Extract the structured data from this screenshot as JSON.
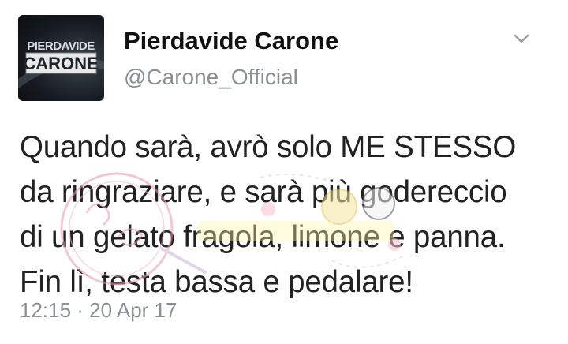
{
  "author": {
    "display_name": "Pierdavide Carone",
    "handle": "@Carone_Official",
    "avatar_lines": [
      "PIERDAVIDE",
      "CARONE"
    ]
  },
  "menu": {
    "icon": "chevron-down-icon"
  },
  "tweet": {
    "lines": [
      "Quando sarà, avrò solo ME STESSO",
      "da ringraziare, e sarà più godereccio",
      "di un gelato fragola, limone e panna.",
      "Fin lì, testa bassa e pedalare!"
    ],
    "timestamp": "12:15 · 20 Apr 17"
  },
  "colors": {
    "text": "#222222",
    "secondary": "#8a8f94",
    "watermark": "#e89ab4"
  }
}
